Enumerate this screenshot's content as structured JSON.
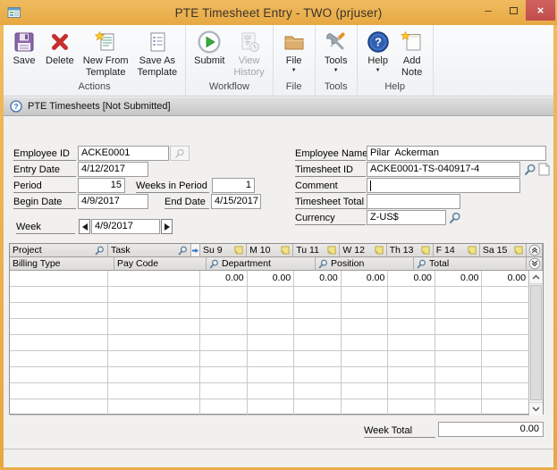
{
  "window": {
    "title": "PTE Timesheet Entry - TWO (prjuser)",
    "minimize_glyph": "–",
    "close_glyph": "×"
  },
  "toolbar": {
    "groups": {
      "actions": "Actions",
      "workflow": "Workflow",
      "file": "File",
      "tools": "Tools",
      "help": "Help"
    },
    "buttons": {
      "save": "Save",
      "delete": "Delete",
      "new_from_template_1": "New From",
      "new_from_template_2": "Template",
      "save_as_template_1": "Save As",
      "save_as_template_2": "Template",
      "submit": "Submit",
      "view_history_1": "View",
      "view_history_2": "History",
      "file": "File",
      "tools": "Tools",
      "help": "Help",
      "add_note_1": "Add",
      "add_note_2": "Note"
    }
  },
  "statusbar": {
    "text": "PTE Timesheets [Not Submitted]"
  },
  "form": {
    "employee_id": {
      "label": "Employee ID",
      "value": "ACKE0001"
    },
    "entry_date": {
      "label": "Entry Date",
      "value": "4/12/2017"
    },
    "period": {
      "label": "Period",
      "value": "15"
    },
    "weeks_in_period": {
      "label": "Weeks in Period",
      "value": "1"
    },
    "begin_date": {
      "label": "Begin Date",
      "value": "4/9/2017"
    },
    "end_date": {
      "label": "End Date",
      "value": "4/15/2017"
    },
    "week": {
      "label": "Week",
      "value": "4/9/2017"
    },
    "employee_name": {
      "label": "Employee Name",
      "value": "Pilar  Ackerman"
    },
    "timesheet_id": {
      "label": "Timesheet ID",
      "value": "ACKE0001-TS-040917-4"
    },
    "comment": {
      "label": "Comment",
      "value": ""
    },
    "timesheet_total": {
      "label": "Timesheet Total",
      "value": ""
    },
    "currency": {
      "label": "Currency",
      "value": "Z-US$"
    }
  },
  "grid": {
    "project_header": "Project",
    "task_header": "Task",
    "days": [
      "Su 9",
      "M 10",
      "Tu 11",
      "W 12",
      "Th 13",
      "F 14",
      "Sa 15"
    ],
    "billing_type_header": "Billing Type",
    "pay_code_header": "Pay Code",
    "department_header": "Department",
    "position_header": "Position",
    "total_header": "Total",
    "hours_values": [
      "0.00",
      "0.00",
      "0.00",
      "0.00",
      "0.00",
      "0.00",
      "0.00"
    ],
    "empty_rows": 8
  },
  "footer": {
    "week_total_label": "Week Total",
    "week_total_value": "0.00"
  },
  "colors": {
    "titlebar_gold": "#E9AC4B",
    "close_red": "#C75454",
    "submit_green": "#35AD3F",
    "note_yellow": "#F2E387",
    "help_blue": "#2E5FB0",
    "save_purple": "#8A64A9",
    "delete_red": "#C62F2F",
    "folder_tan": "#DCAF6F",
    "statusbar_gray": "#D3D3D3"
  }
}
